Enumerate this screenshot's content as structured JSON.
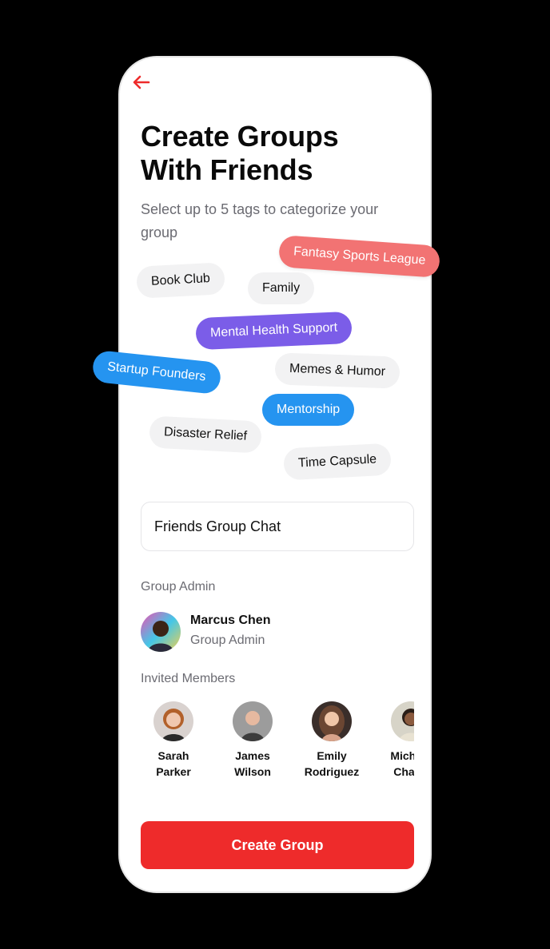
{
  "header": {
    "title": "Create Groups With Friends",
    "subtitle": "Select up to 5 tags to categorize your group"
  },
  "tags": [
    {
      "label": "Fantasy Sports League",
      "state": "selected",
      "color": "#f27373"
    },
    {
      "label": "Book Club",
      "state": "unselected"
    },
    {
      "label": "Family",
      "state": "unselected"
    },
    {
      "label": "Mental Health Support",
      "state": "selected",
      "color": "#7b5de8"
    },
    {
      "label": "Startup Founders",
      "state": "selected",
      "color": "#2594f0"
    },
    {
      "label": "Memes & Humor",
      "state": "unselected"
    },
    {
      "label": "Mentorship",
      "state": "selected",
      "color": "#2594f0"
    },
    {
      "label": "Disaster Relief",
      "state": "unselected"
    },
    {
      "label": "Time Capsule",
      "state": "unselected"
    }
  ],
  "group_name": {
    "value": "Friends Group Chat"
  },
  "admin": {
    "section_label": "Group Admin",
    "name": "Marcus Chen",
    "role": "Group Admin"
  },
  "members": {
    "section_label": "Invited Members",
    "items": [
      {
        "name": "Sarah\nParker"
      },
      {
        "name": "James\nWilson"
      },
      {
        "name": "Emily\nRodriguez"
      },
      {
        "name": "Michael\nChang"
      }
    ]
  },
  "actions": {
    "create_label": "Create Group"
  },
  "colors": {
    "accent": "#ee2b2b",
    "muted_text": "#6b6b72"
  }
}
